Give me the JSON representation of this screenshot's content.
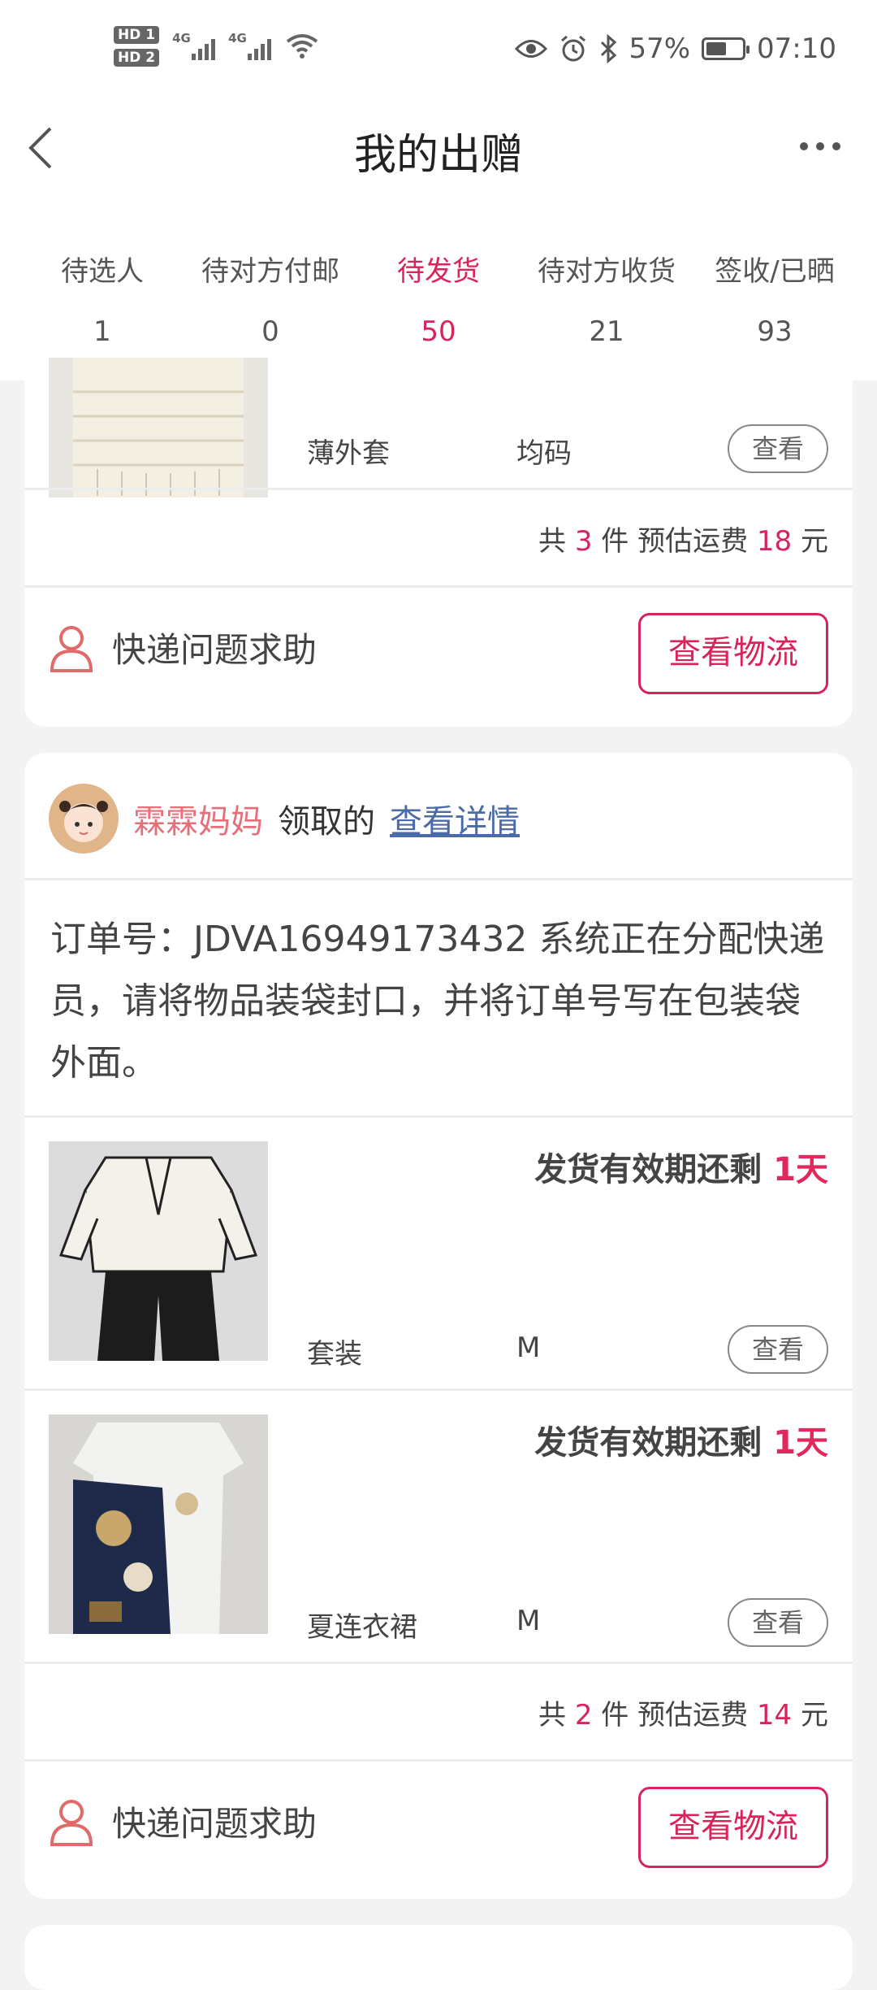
{
  "status_bar": {
    "sim1": "HD 1",
    "sim2": "HD 2",
    "network1": "4G",
    "network2": "4G",
    "battery_percent": "57%",
    "battery_level": 0.57,
    "time": "07:10",
    "icons": [
      "eye-icon",
      "alarm-icon",
      "bluetooth-icon",
      "wifi-icon"
    ]
  },
  "header": {
    "title": "我的出赠"
  },
  "tabs": [
    {
      "label": "待选人",
      "count": "1"
    },
    {
      "label": "待对方付邮",
      "count": "0"
    },
    {
      "label": "待发货",
      "count": "50",
      "active": true
    },
    {
      "label": "待对方收货",
      "count": "21"
    },
    {
      "label": "签收/已晒",
      "count": "93"
    }
  ],
  "colors": {
    "accent": "#e3275c",
    "accent_text": "#d8245a",
    "link": "#4a6aa8",
    "username": "#e6707a"
  },
  "orders": [
    {
      "items": [
        {
          "name": "薄外套",
          "size": "均码",
          "action": "查看"
        }
      ],
      "summary": {
        "prefix": "共",
        "count": "3",
        "mid": "件 预估运费",
        "fee": "18",
        "unit": "元"
      },
      "help": "快递问题求助",
      "logistics_button": "查看物流"
    },
    {
      "user": {
        "name": "霖霖妈妈",
        "action_text": "领取的",
        "detail_link": "查看详情"
      },
      "order_text": "订单号：JDVA16949173432 系统正在分配快递员，请将物品装袋封口，并将订单号写在包装袋外面。",
      "items": [
        {
          "deadline_label": "发货有效期还剩",
          "deadline_value": "1天",
          "name": "套装",
          "size": "M",
          "action": "查看"
        },
        {
          "deadline_label": "发货有效期还剩",
          "deadline_value": "1天",
          "name": "夏连衣裙",
          "size": "M",
          "action": "查看"
        }
      ],
      "summary": {
        "prefix": "共",
        "count": "2",
        "mid": "件 预估运费",
        "fee": "14",
        "unit": "元"
      },
      "help": "快递问题求助",
      "logistics_button": "查看物流"
    }
  ]
}
